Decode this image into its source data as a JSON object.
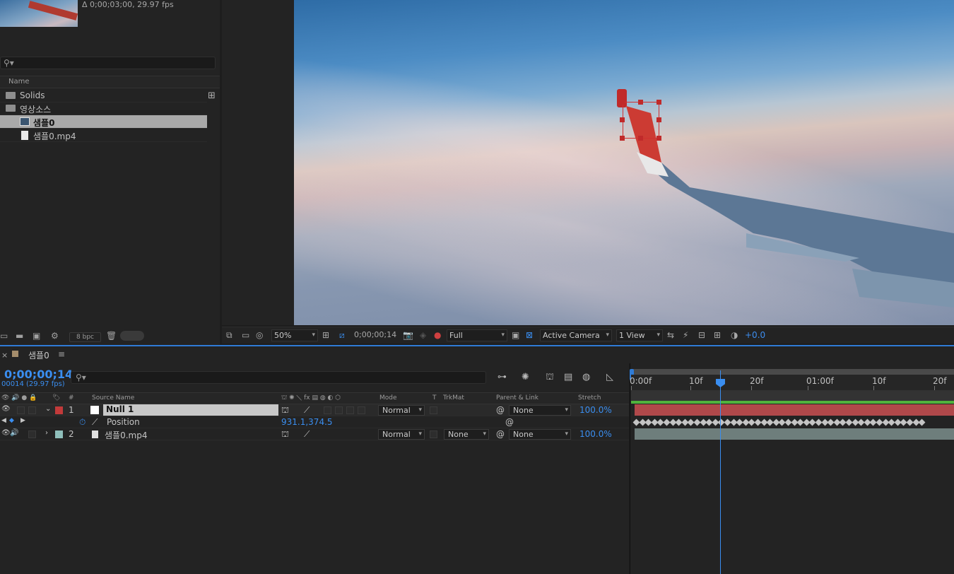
{
  "project": {
    "info": "Δ 0;00;03;00, 29.97 fps",
    "header_name": "Name",
    "items": [
      {
        "label": "Solids",
        "type": "folder"
      },
      {
        "label": "영상소스",
        "type": "folder"
      },
      {
        "label": "샘플0",
        "type": "composition",
        "selected": true
      },
      {
        "label": "샘플0.mp4",
        "type": "footage"
      }
    ],
    "bpc": "8 bpc"
  },
  "viewer_toolbar": {
    "zoom": "50%",
    "timecode": "0;00;00;14",
    "resolution": "Full",
    "camera": "Active Camera",
    "views": "1 View",
    "exposure": "+0.0"
  },
  "timeline": {
    "comp_name": "샘플0",
    "timecode": "0;00;00;14",
    "frame_fps": "00014 (29.97 fps)",
    "columns": {
      "source_name": "Source Name",
      "mode": "Mode",
      "t": "T",
      "trkmat": "TrkMat",
      "parent": "Parent & Link",
      "stretch": "Stretch"
    },
    "layers": [
      {
        "num": "1",
        "name": "Null 1",
        "mode": "Normal",
        "parent": "None",
        "stretch": "100.0%",
        "color": "#c23a3a"
      },
      {
        "num": "2",
        "name": "샘플0.mp4",
        "mode": "Normal",
        "trkmat": "None",
        "parent": "None",
        "stretch": "100.0%",
        "color": "#8fbfbb"
      }
    ],
    "property": {
      "name": "Position",
      "value": "931.1,374.5"
    },
    "ruler_labels": [
      "0:00f",
      "10f",
      "20f",
      "01:00f",
      "10f",
      "20f"
    ],
    "current_frame": 14
  },
  "colors": {
    "accent": "#3a8ef0",
    "layer1": "#b0484a",
    "layer2": "#6e7e7c",
    "work_area": "#4fb33d"
  }
}
